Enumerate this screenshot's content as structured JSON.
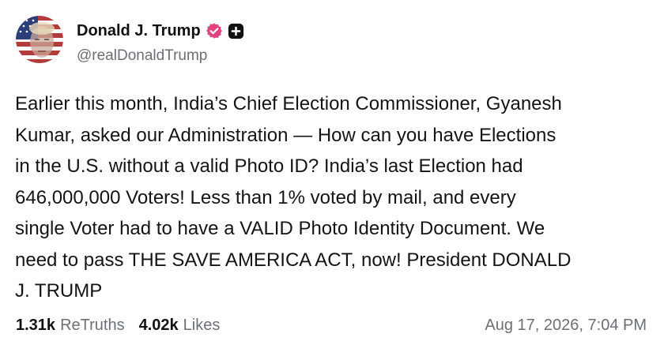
{
  "author": {
    "display_name": "Donald J. Trump",
    "handle": "@realDonaldTrump",
    "verified_icon": "verified-badge-icon",
    "verified_color": "#e0447f",
    "plus_icon": "plus-badge-icon"
  },
  "post": {
    "lines": [
      "Earlier this month, India’s Chief Election Commissioner, Gyanesh",
      "Kumar, asked our Administration — How can you have Elections",
      "in the U.S. without a valid Photo ID? India’s last Election had",
      "646,000,000 Voters! Less than 1% voted by mail, and every",
      "single Voter had to have a VALID Photo Identity Document. We",
      "need to pass THE SAVE AMERICA ACT, now! President DONALD",
      "J. TRUMP"
    ]
  },
  "stats": {
    "retruths_count": "1.31k",
    "retruths_label": "ReTruths",
    "likes_count": "4.02k",
    "likes_label": "Likes"
  },
  "timestamp": "Aug 17, 2026, 7:04 PM",
  "colors": {
    "text": "#141414",
    "muted": "#6b6f76",
    "background": "#ffffff"
  }
}
